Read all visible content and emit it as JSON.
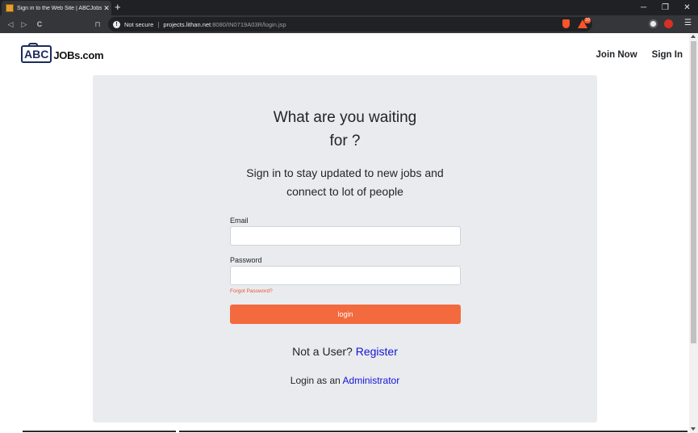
{
  "browser": {
    "tab_title": "Sign in to the Web Site | ABCJobs",
    "tab_close": "✕",
    "new_tab": "+",
    "window_controls": {
      "minimize": "─",
      "restore": "❐",
      "close": "✕"
    },
    "nav": {
      "back": "◁",
      "forward": "▷",
      "reload": "C",
      "bookmark": "⊓"
    },
    "security_label": "Not secure",
    "url_separator": "|",
    "url_host": "projects.lithan.net",
    "url_path": ":8080/IN0719A03R/login.jsp",
    "rewards_count": "10",
    "menu": "☰"
  },
  "header": {
    "logo_abc": "ABC",
    "logo_text": "JOBs.com",
    "nav": [
      {
        "label": "Join Now"
      },
      {
        "label": "Sign In"
      }
    ]
  },
  "main": {
    "headline_line1": "What are you waiting",
    "headline_line2": "for ?",
    "subline_line1": "Sign in to stay updated to new jobs and",
    "subline_line2": "connect to lot of people",
    "email_label": "Email",
    "email_value": "",
    "password_label": "Password",
    "password_value": "",
    "forgot_password": "Forgot Password?",
    "login_button": "login",
    "register_prefix": "Not a User?",
    "register_link": "Register",
    "admin_prefix": "Login as an",
    "admin_link": "Administrator"
  },
  "colors": {
    "accent": "#f26a3d",
    "link": "#1515d6",
    "card": "#e9ebee"
  }
}
